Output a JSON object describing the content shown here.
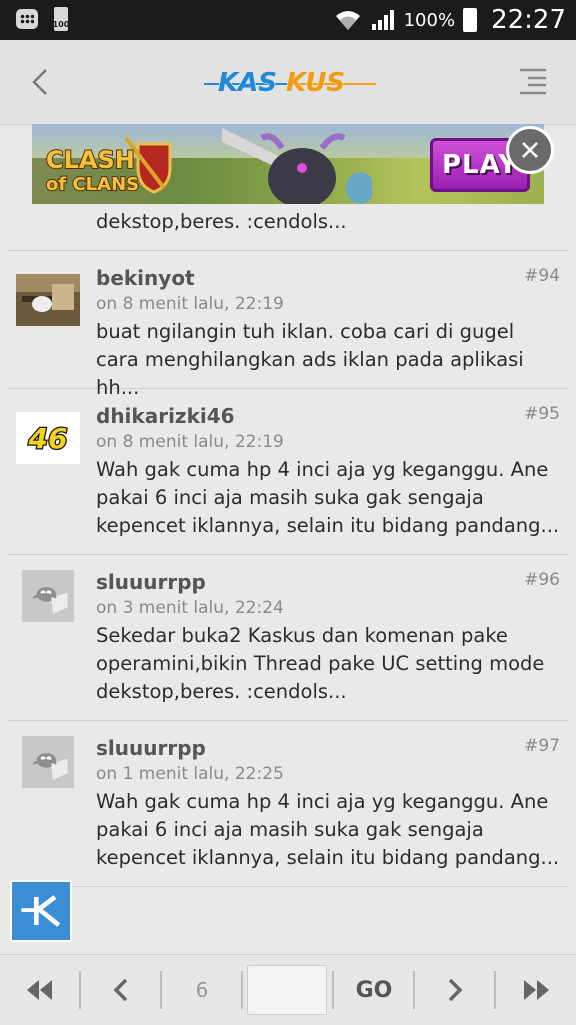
{
  "status_bar": {
    "battery_small_label": "100",
    "battery_percent": "100%",
    "time": "22:27"
  },
  "header": {
    "logo_text": "KASKUS",
    "back_icon": "chevron-left-icon",
    "menu_icon": "list-menu-icon"
  },
  "ad": {
    "game_title": "CLASH of CLANS",
    "play_label": "PLAY"
  },
  "partial_post": {
    "text": "dekstop,beres. :cendols..."
  },
  "posts": [
    {
      "username": "bekinyot",
      "number": "#94",
      "meta": "on 8 menit lalu, 22:19",
      "text": "buat ngilangin tuh iklan. coba cari di gugel cara menghilangkan ads iklan pada aplikasi hh..."
    },
    {
      "username": "dhikarizki46",
      "number": "#95",
      "meta": "on 8 menit lalu, 22:19",
      "avatar_text": "46",
      "text": "Wah gak cuma hp 4 inci aja yg keganggu. Ane pakai 6 inci aja masih suka gak sengaja kepencet iklannya, selain itu bidang pandang..."
    },
    {
      "username": "sluuurrpp",
      "number": "#96",
      "meta": "on 3 menit lalu, 22:24",
      "text": "Sekedar buka2 Kaskus dan komenan pake operamini,bikin Thread pake UC setting mode dekstop,beres. :cendols..."
    },
    {
      "username": "sluuurrpp",
      "number": "#97",
      "meta": "on 1 menit lalu, 22:25",
      "text": "Wah gak cuma hp 4 inci aja yg keganggu. Ane pakai 6 inci aja masih suka gak sengaja kepencet iklannya, selain itu bidang pandang..."
    }
  ],
  "pager": {
    "page": "6",
    "go_label": "GO",
    "page_input_value": ""
  },
  "colors": {
    "brand_blue": "#1e8ad6",
    "brand_orange": "#f39c12",
    "fab_blue": "#3a8ed3"
  }
}
